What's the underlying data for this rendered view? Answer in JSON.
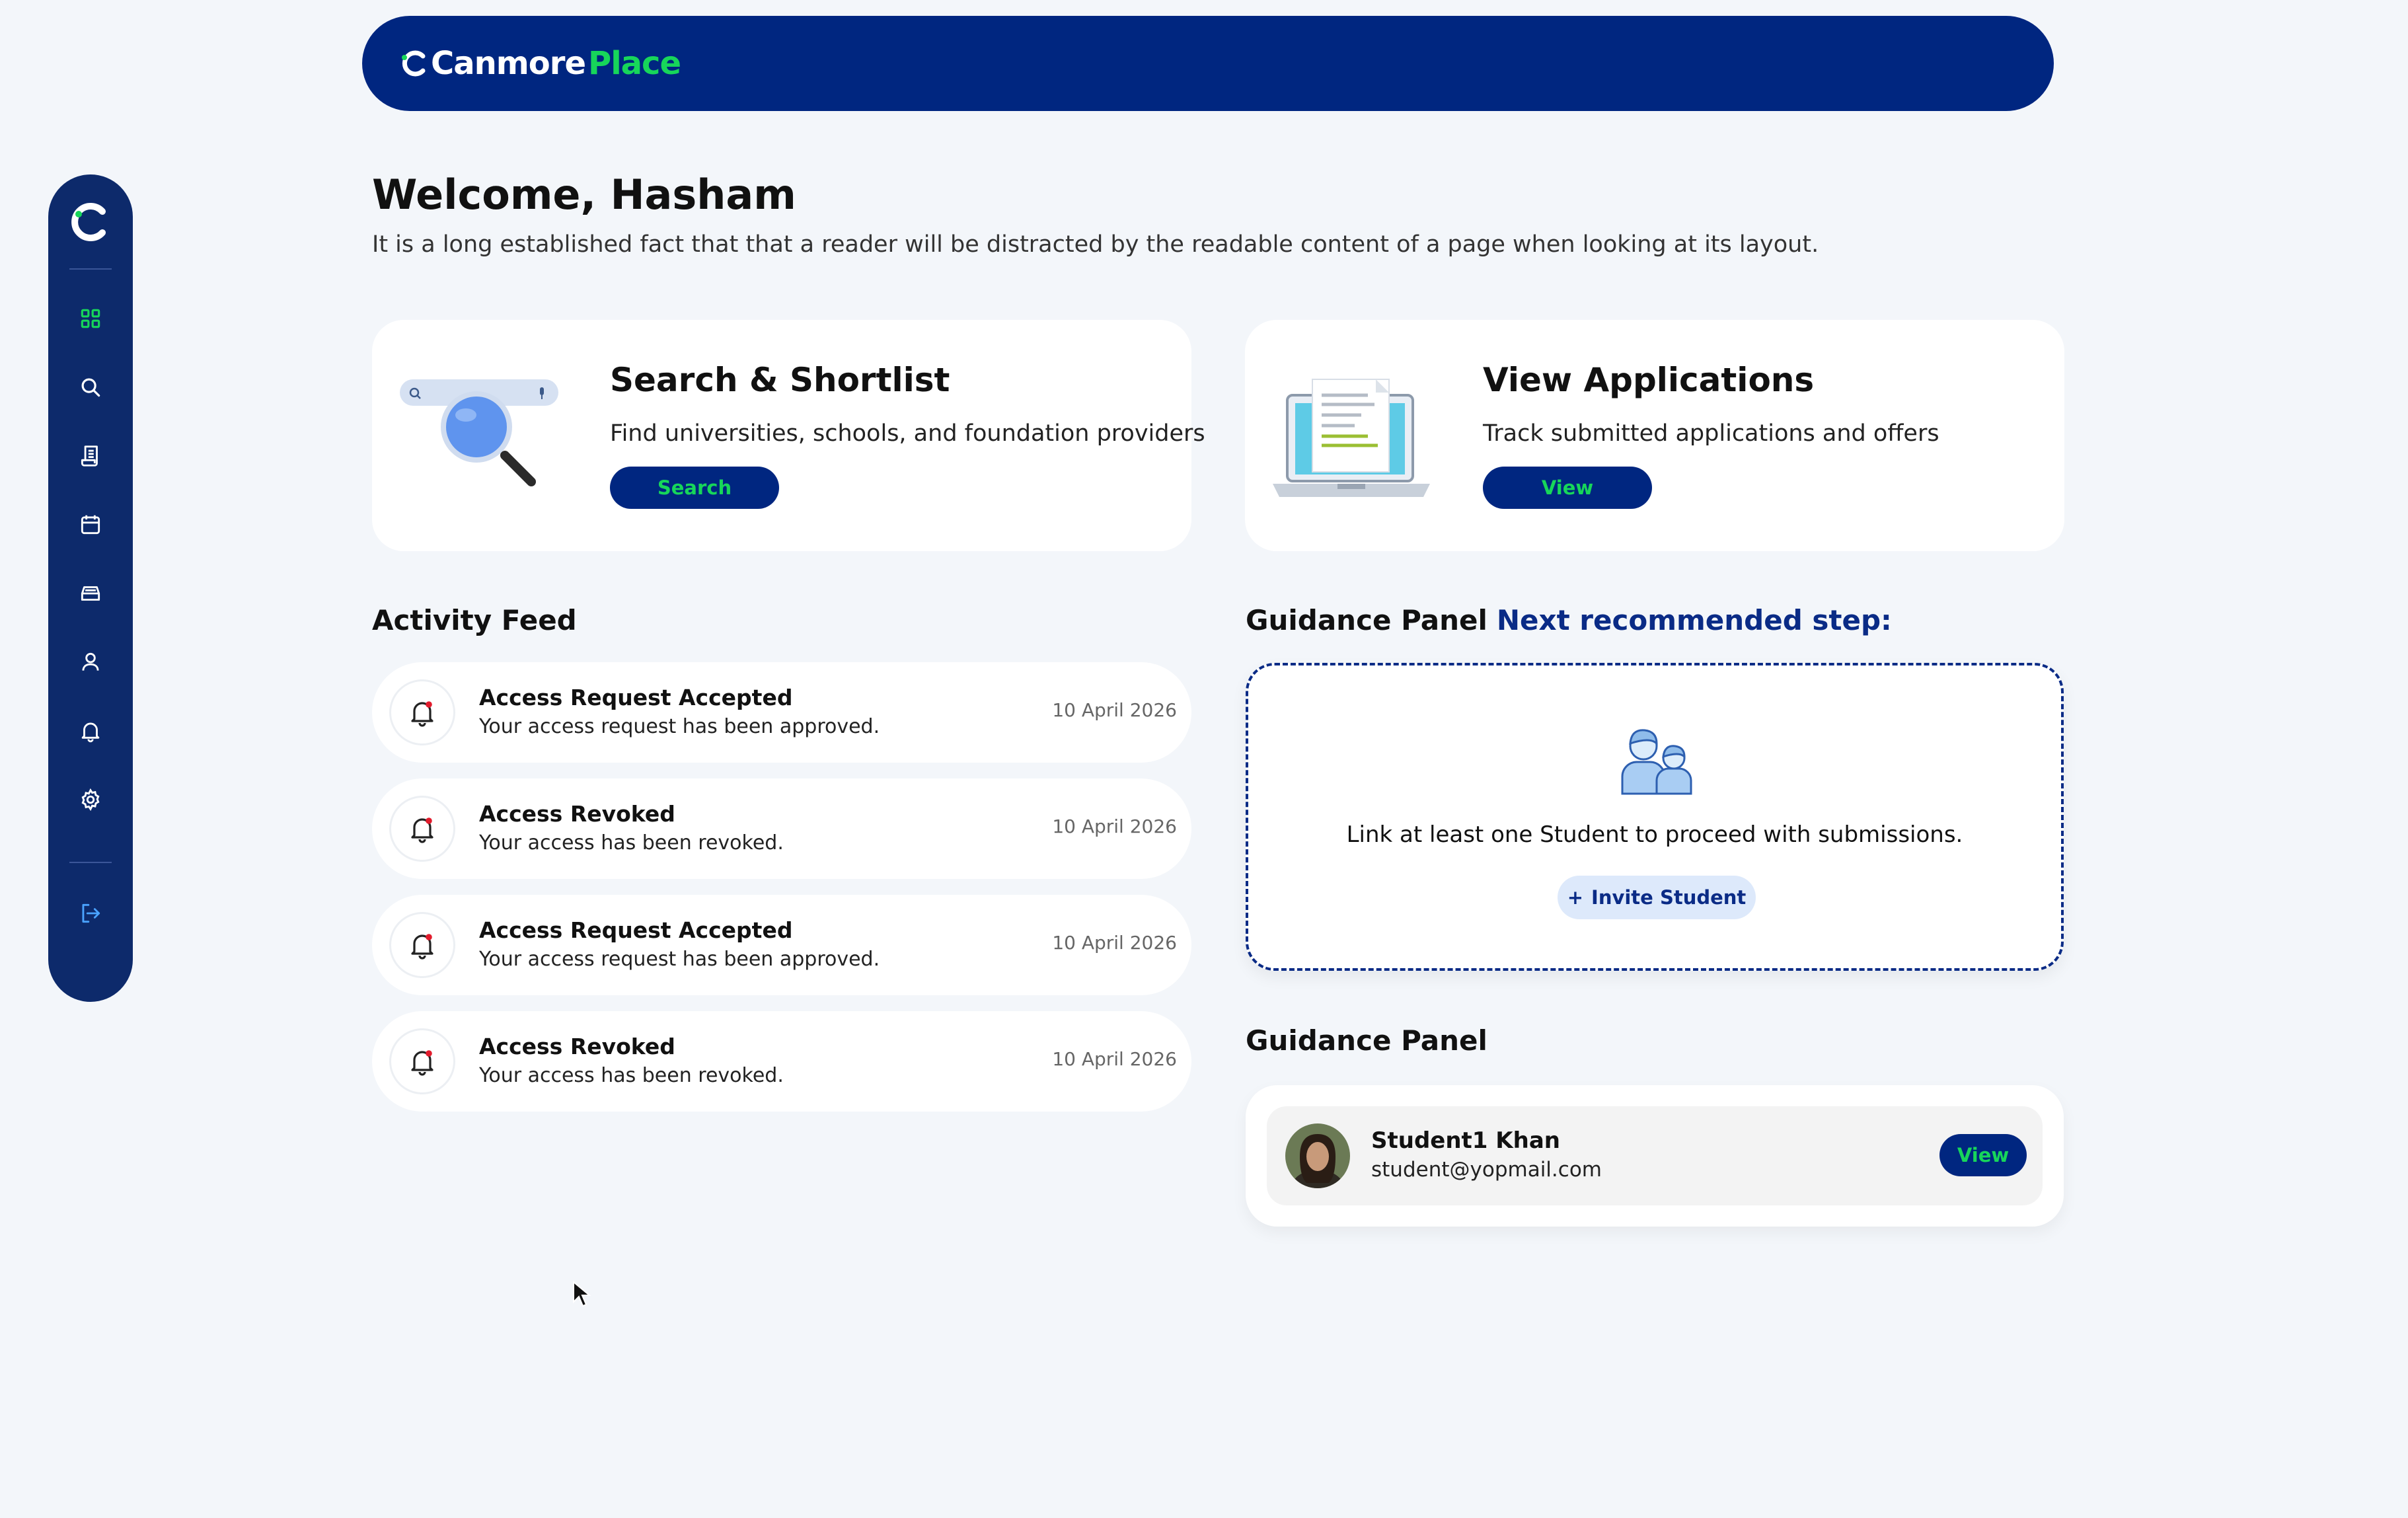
{
  "brand": {
    "part1": "Canmore",
    "part2": "Place",
    "primary_color": "#002680",
    "accent_color": "#17d65a"
  },
  "sidebar": {
    "items": [
      {
        "name": "dashboard",
        "icon": "grid-icon",
        "active": true
      },
      {
        "name": "search",
        "icon": "search-icon"
      },
      {
        "name": "applications",
        "icon": "document-icon"
      },
      {
        "name": "calendar",
        "icon": "calendar-icon"
      },
      {
        "name": "inbox",
        "icon": "inbox-icon"
      },
      {
        "name": "profile",
        "icon": "user-icon"
      },
      {
        "name": "notifications",
        "icon": "bell-icon"
      },
      {
        "name": "settings",
        "icon": "gear-icon"
      },
      {
        "name": "logout",
        "icon": "logout-icon"
      }
    ]
  },
  "welcome": {
    "title": "Welcome, Hasham",
    "subtitle": "It is a long established fact that that a reader will be distracted by the readable content of a page when looking at its layout."
  },
  "cards": {
    "search": {
      "title": "Search & Shortlist",
      "description": "Find universities, schools, and foundation providers",
      "button": "Search"
    },
    "applications": {
      "title": "View Applications",
      "description": "Track submitted applications and offers",
      "button": "View"
    }
  },
  "activity_feed": {
    "heading": "Activity Feed",
    "items": [
      {
        "title": "Access Request Accepted",
        "description": "Your access request has been approved.",
        "date": "10 April 2026"
      },
      {
        "title": "Access Revoked",
        "description": "Your access has been revoked.",
        "date": "10 April 2026"
      },
      {
        "title": "Access Request Accepted",
        "description": "Your access request has been approved.",
        "date": "10 April 2026"
      },
      {
        "title": "Access Revoked",
        "description": "Your access has been revoked.",
        "date": "10 April 2026"
      }
    ]
  },
  "guidance": {
    "heading": "Guidance Panel",
    "next_step_label": "Next recommended step:",
    "message": "Link at least one Student to proceed with submissions.",
    "invite_button": "Invite Student"
  },
  "student_panel": {
    "heading": "Guidance Panel",
    "student": {
      "name": "Student1 Khan",
      "email": "student@yopmail.com"
    },
    "button": "View"
  }
}
